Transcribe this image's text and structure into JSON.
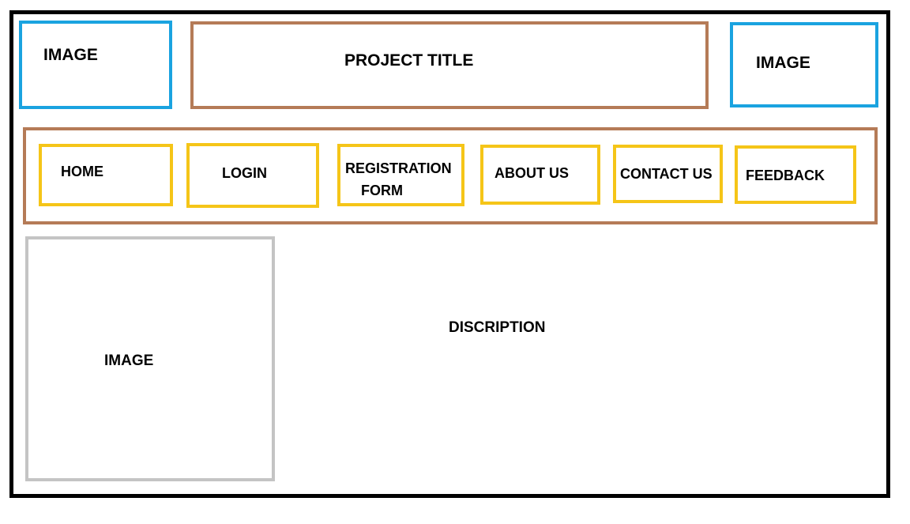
{
  "header": {
    "left_image": "IMAGE",
    "title": "PROJECT TITLE",
    "right_image": "IMAGE"
  },
  "nav": {
    "items": [
      {
        "label": "HOME"
      },
      {
        "label": "LOGIN"
      },
      {
        "label_line1": "REGISTRATION",
        "label_line2": "FORM"
      },
      {
        "label": "ABOUT US"
      },
      {
        "label": "CONTACT US"
      },
      {
        "label": "FEEDBACK"
      }
    ]
  },
  "content": {
    "image": "IMAGE",
    "description": "DISCRIPTION"
  },
  "colors": {
    "frame": "#000000",
    "image_box": "#1aa3e0",
    "title_and_nav_box": "#b57b57",
    "nav_item": "#f5c518",
    "content_image_box": "#c4c4c4"
  }
}
